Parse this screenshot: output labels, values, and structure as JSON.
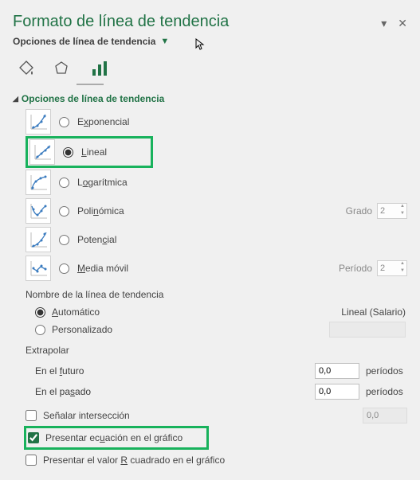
{
  "header": {
    "title": "Formato de línea de tendencia",
    "subhead": "Opciones de línea de tendencia"
  },
  "section": {
    "title": "Opciones de línea de tendencia"
  },
  "trend": {
    "exponential": "Exponencial",
    "linear": "Lineal",
    "logarithmic": "Logarítmica",
    "polynomial": "Polinómica",
    "power": "Potencial",
    "moving": "Media móvil",
    "degree_label": "Grado",
    "degree_value": "2",
    "period_label": "Período",
    "period_value": "2"
  },
  "name": {
    "heading": "Nombre de la línea de tendencia",
    "auto": "Automático",
    "custom": "Personalizado",
    "auto_value": "Lineal (Salario)"
  },
  "extrap": {
    "heading": "Extrapolar",
    "forward": "En el futuro",
    "backward": "En el pasado",
    "fval": "0,0",
    "bval": "0,0",
    "unit": "períodos"
  },
  "checks": {
    "intercept": "Señalar intersección",
    "intercept_val": "0,0",
    "equation": "Presentar ecuación en el gráfico",
    "r2": "Presentar el valor R cuadrado en el gráfico"
  }
}
